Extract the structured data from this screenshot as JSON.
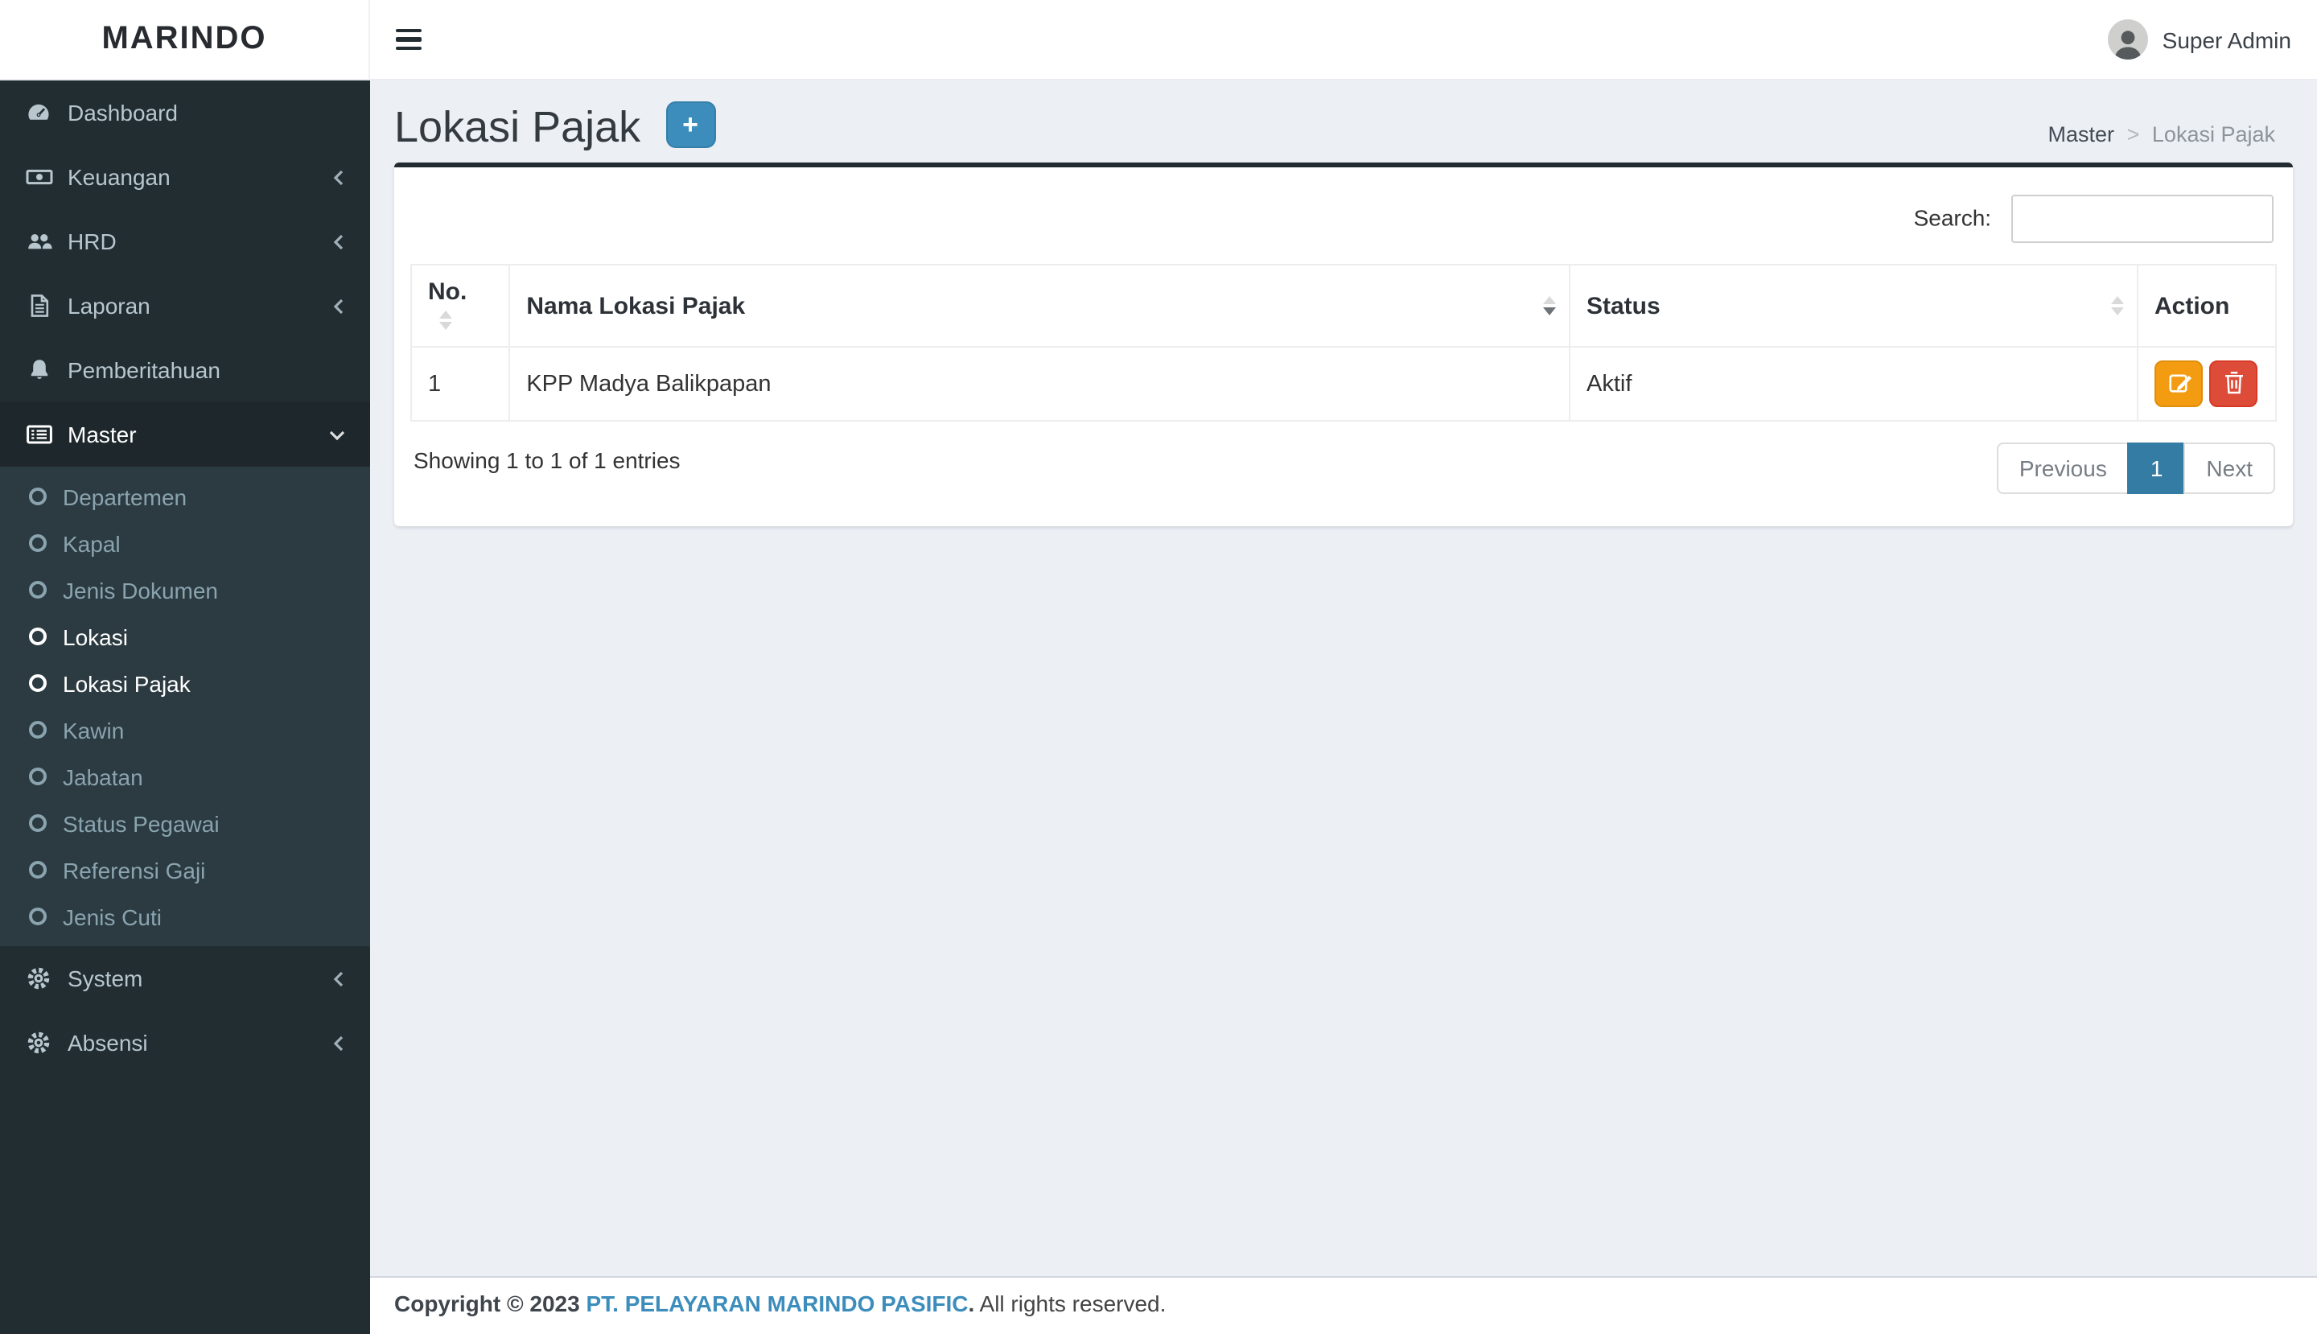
{
  "app": {
    "brand": "MARINDO",
    "user": "Super Admin"
  },
  "sidebar": {
    "items": [
      {
        "label": "Dashboard",
        "icon": "dashboard-icon",
        "chevron": null
      },
      {
        "label": "Keuangan",
        "icon": "money-icon",
        "chevron": "left"
      },
      {
        "label": "HRD",
        "icon": "users-icon",
        "chevron": "left"
      },
      {
        "label": "Laporan",
        "icon": "document-icon",
        "chevron": "left"
      },
      {
        "label": "Pemberitahuan",
        "icon": "bell-icon",
        "chevron": null
      },
      {
        "label": "Master",
        "icon": "list-icon",
        "chevron": "down",
        "active": true
      }
    ],
    "master_submenu": [
      {
        "label": "Departemen",
        "active": false
      },
      {
        "label": "Kapal",
        "active": false
      },
      {
        "label": "Jenis Dokumen",
        "active": false
      },
      {
        "label": "Lokasi",
        "active": true
      },
      {
        "label": "Lokasi Pajak",
        "active": true
      },
      {
        "label": "Kawin",
        "active": false
      },
      {
        "label": "Jabatan",
        "active": false
      },
      {
        "label": "Status Pegawai",
        "active": false
      },
      {
        "label": "Referensi Gaji",
        "active": false
      },
      {
        "label": "Jenis Cuti",
        "active": false
      }
    ],
    "items_after": [
      {
        "label": "System",
        "icon": "gear-icon",
        "chevron": "left"
      },
      {
        "label": "Absensi",
        "icon": "gear-icon",
        "chevron": "left"
      }
    ]
  },
  "header": {
    "title": "Lokasi Pajak",
    "add_button": "+",
    "breadcrumb": {
      "parent": "Master",
      "separator": ">",
      "current": "Lokasi Pajak"
    }
  },
  "table": {
    "search_label": "Search:",
    "search_value": "",
    "columns": [
      "No.",
      "Nama Lokasi Pajak",
      "Status",
      "Action"
    ],
    "sort_state": {
      "no": "none",
      "nama": "desc",
      "status": "none"
    },
    "rows": [
      {
        "no": "1",
        "nama": "KPP Madya Balikpapan",
        "status": "Aktif"
      }
    ],
    "info": "Showing 1 to 1 of 1 entries",
    "pagination": {
      "previous": "Previous",
      "page": "1",
      "next": "Next"
    }
  },
  "footer": {
    "copyright": "Copyright © 2023",
    "company": "PT. PELAYARAN MARINDO PASIFIC",
    "period": ".",
    "rights": "All rights reserved."
  },
  "icons": {
    "dashboard-icon": "gauge",
    "money-icon": "banknote",
    "users-icon": "people-group",
    "document-icon": "file-text",
    "bell-icon": "bell",
    "list-icon": "th-list",
    "gear-icon": "gear",
    "circle-icon": "circle-o",
    "edit-icon": "pencil-square",
    "delete-icon": "trash",
    "laravel-icon": "laravel-logomark",
    "hamburger-icon": "bars"
  },
  "colors": {
    "accent": "#3c8dbc",
    "pagination_active": "#357ca5",
    "warning": "#f39c12",
    "danger": "#dd4b39",
    "sidebar_bg": "#222d32",
    "submenu_bg": "#2c3b41",
    "active_item_bg": "#1e282c",
    "content_bg": "#ecf0f5",
    "card_top_border": "#212b30",
    "debugbar_red": "#e74430"
  }
}
